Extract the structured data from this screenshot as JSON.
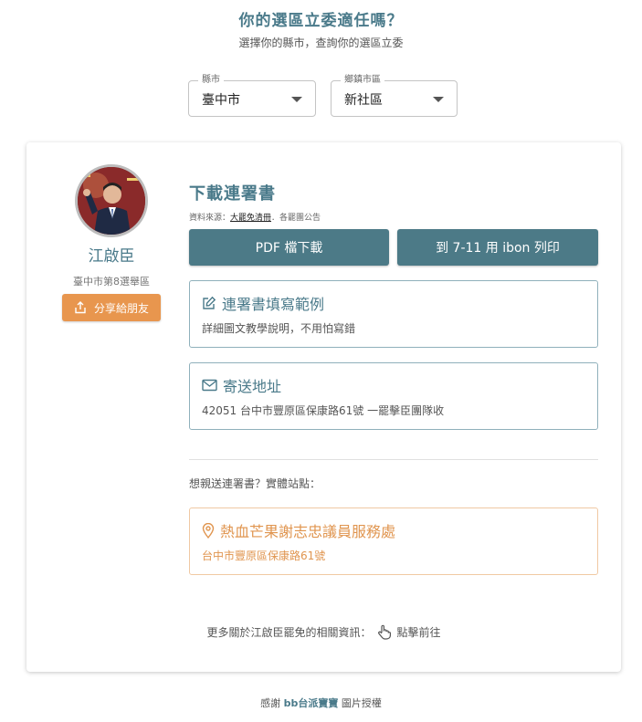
{
  "header": {
    "title": "你的選區立委適任嗎？",
    "subtitle": "選擇你的縣市，查詢你的選區立委"
  },
  "filters": {
    "city": {
      "label": "縣市",
      "value": "臺中市"
    },
    "district": {
      "label": "鄉鎮市區",
      "value": "新社區"
    }
  },
  "legislator": {
    "name": "江啟臣",
    "district": "臺中市第8選舉區",
    "share_label": "分享給朋友"
  },
  "download": {
    "title": "下載連署書",
    "source_prefix": "資料來源：",
    "source_link": "大罷免清冊",
    "source_suffix": "．各罷團公告",
    "pdf_label": "PDF 檔下載",
    "ibon_label": "到 7-11 用 ibon 列印"
  },
  "example_box": {
    "title": "連署書填寫範例",
    "desc": "詳細圖文教學說明，不用怕寫錯"
  },
  "address_box": {
    "title": "寄送地址",
    "desc": "42051 台中市豐原區保康路61號 一罷擊臣團隊收"
  },
  "in_person": {
    "prompt": "想親送連署書？實體站點：",
    "office_name": "熱血芒果謝志忠議員服務處",
    "office_address": "台中市豐原區保康路61號"
  },
  "more": {
    "text": "更多關於江啟臣罷免的相關資訊：",
    "link": "點擊前往"
  },
  "footer": {
    "prefix": "感謝",
    "brand": "bb台派寶寶",
    "suffix": "圖片授權"
  },
  "colors": {
    "teal": "#4c7a87",
    "orange": "#e8964e"
  }
}
